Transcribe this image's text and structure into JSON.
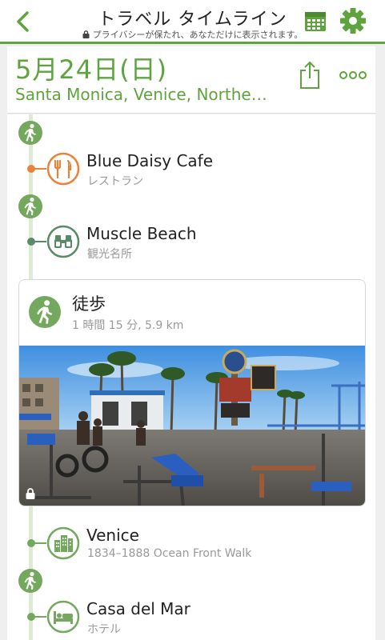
{
  "nav": {
    "title": "トラベル タイムライン",
    "privacy_note": "プライバシーが保たれ、あなただけに表示されます。",
    "back_icon": "chevron-left-icon",
    "calendar_icon": "calendar-icon",
    "settings_icon": "gear-icon",
    "accent_color": "#5fa33e"
  },
  "day": {
    "date": "5月24日(日)",
    "places": "Santa Monica, Venice, Northe…",
    "share_icon": "share-icon",
    "more_icon": "more-icon"
  },
  "timeline": {
    "stops": [
      {
        "name": "Blue Daisy Cafe",
        "category": "レストラン",
        "icon": "restaurant-icon",
        "color": "#e8833a"
      },
      {
        "name": "Muscle Beach",
        "category": "観光名所",
        "icon": "binoculars-icon",
        "color": "#5b8a66"
      },
      {
        "name": "Venice",
        "category": "1834–1888 Ocean Front Walk",
        "icon": "city-icon",
        "color": "#74a85e"
      },
      {
        "name": "Casa del Mar",
        "category": "ホテル",
        "icon": "hotel-icon",
        "color": "#74a85e"
      }
    ],
    "walk_card": {
      "title": "徒歩",
      "details": "1 時間 15 分, 5.9 km",
      "icon": "walking-icon"
    }
  }
}
